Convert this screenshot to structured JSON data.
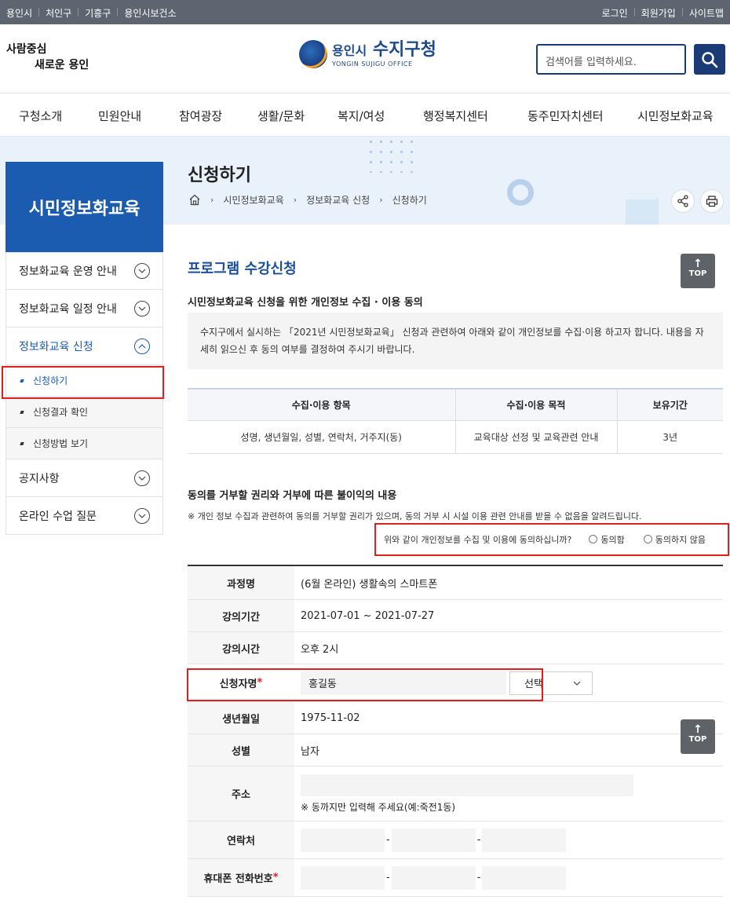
{
  "topbar": {
    "left_links": [
      "용인시",
      "처인구",
      "기흥구",
      "용인시보건소"
    ],
    "right_links": [
      "로그인",
      "회원가입",
      "사이트맵"
    ]
  },
  "header": {
    "slogan_line1": "사람중심",
    "slogan_line2": "새로운 용인",
    "logo_city": "용인시",
    "logo_office": "수지구청",
    "logo_en": "YONGIN SUJIGU OFFICE",
    "search_placeholder": "검색어를 입력하세요.",
    "search_icon": "search-icon"
  },
  "gnb": [
    "구청소개",
    "민원안내",
    "참여광장",
    "생활/문화",
    "복지/여성",
    "행정복지센터",
    "동주민자치센터",
    "시민정보화교육"
  ],
  "page": {
    "title": "신청하기",
    "breadcrumb": [
      "시민정보화교육",
      "정보화교육 신청",
      "신청하기"
    ]
  },
  "lnb": {
    "title": "시민정보화교육",
    "items": [
      {
        "label": "정보화교육 운영 안내"
      },
      {
        "label": "정보화교육 일정 안내"
      },
      {
        "label": "정보화교육 신청"
      },
      {
        "label": "공지사항"
      },
      {
        "label": "온라인 수업 질문"
      }
    ],
    "subitems": [
      "신청하기",
      "신청결과 확인",
      "신청방법 보기"
    ]
  },
  "content": {
    "section_title": "프로그램 수강신청",
    "top_label": "TOP",
    "privacy_title": "시민정보화교육 신청을 위한 개인정보 수집 · 이용 동의",
    "privacy_notice": "수지구에서 실시하는 「2021년 시민정보화교육」 신청과 관련하여 아래와 같이 개인정보를 수집·이용 하고자 합니다. 내용을 자세히 읽으신 후 동의 여부를 결정하여 주시기 바랍니다.",
    "table_headers": [
      "수집·이용 항목",
      "수집·이용 목적",
      "보유기간"
    ],
    "table_row": [
      "성명, 생년월일, 성별, 연락처, 거주지(동)",
      "교육대상 선정 및 교육관련 안내",
      "3년"
    ],
    "refuse_title": "동의를 거부할 권리와 거부에 따른 불이익의 내용",
    "refuse_note": "※ 개인 정보 수집과 관련하여 동의를 거부할 권리가 있으며, 동의 거부 시 시설 이용 관련 안내를 받을 수 없음을 알려드립니다.",
    "consent_question": "위와 같이 개인정보를 수집 및 이용에 동의하십니까?",
    "consent_yes": "동의함",
    "consent_no": "동의하지 않음"
  },
  "form": {
    "course_label": "과정명",
    "course_value": "(6월 온라인) 생활속의 스마트폰",
    "period_label": "강의기간",
    "period_value": "2021-07-01 ~ 2021-07-27",
    "time_label": "강의시간",
    "time_value": "오후 2시",
    "name_label": "신청자명",
    "name_value": "홍길동",
    "name_select": "선택",
    "birth_label": "생년월일",
    "birth_value": "1975-11-02",
    "gender_label": "성별",
    "gender_value": "남자",
    "address_label": "주소",
    "address_hint": "※ 동까지만 입력해 주세요(예:죽전1동)",
    "phone_label": "연락처",
    "mobile_label": "휴대폰 전화번호",
    "dash": "-",
    "required_mark": "*"
  }
}
